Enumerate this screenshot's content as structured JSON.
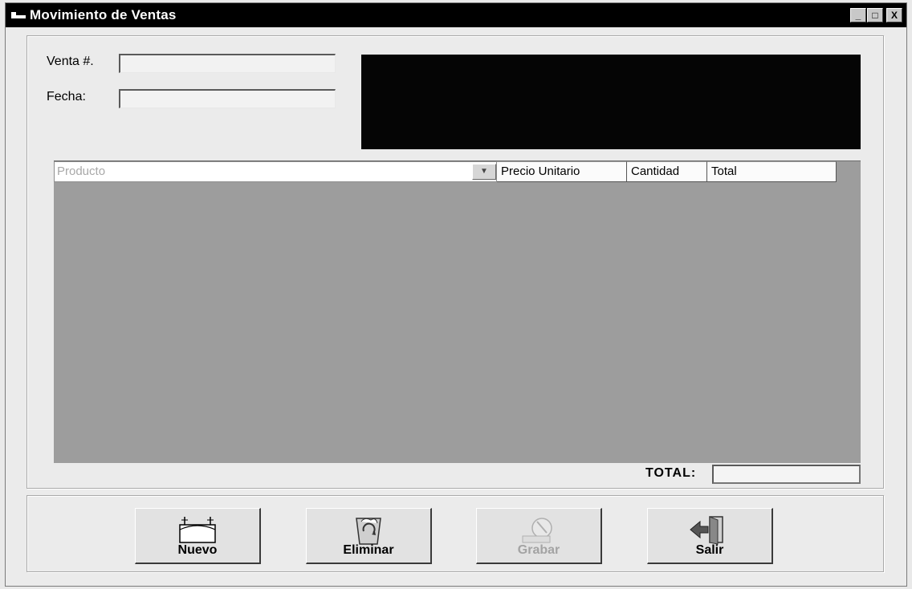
{
  "window": {
    "title": "Movimiento de Ventas",
    "controls": [
      "_",
      "□",
      "X"
    ]
  },
  "form": {
    "venta_label": "Venta  #.",
    "venta_value": "",
    "fecha_label": "Fecha:",
    "fecha_value": ""
  },
  "grid": {
    "combo_placeholder": "Producto",
    "dropdown_icon": "chevron-down-icon",
    "columns": [
      "Precio Unitario",
      "Cantidad",
      "Total"
    ],
    "rows": []
  },
  "total": {
    "label": "TOTAL:",
    "value": ""
  },
  "buttons": [
    {
      "label": "Nuevo",
      "icon": "new-record-icon",
      "enabled": true
    },
    {
      "label": "Eliminar",
      "icon": "recycle-bin-icon",
      "enabled": true
    },
    {
      "label": "Grabar",
      "icon": "save-disk-icon",
      "enabled": false
    },
    {
      "label": "Salir",
      "icon": "exit-door-icon",
      "enabled": true
    }
  ]
}
